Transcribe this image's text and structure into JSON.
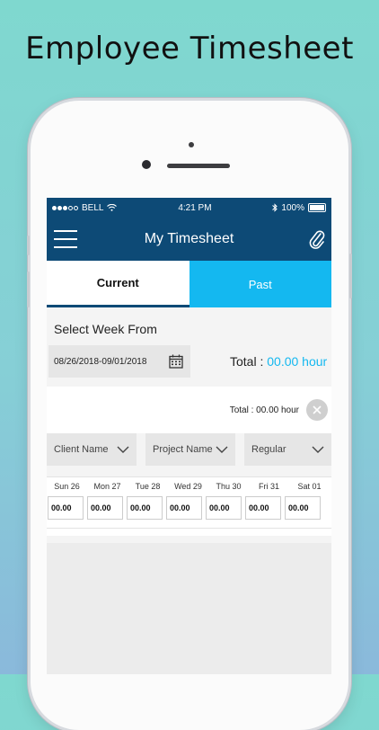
{
  "headline": "Employee Timesheet",
  "status_bar": {
    "carrier": "BELL",
    "time": "4:21 PM",
    "battery": "100%"
  },
  "nav": {
    "title": "My Timesheet"
  },
  "tabs": [
    {
      "label": "Current"
    },
    {
      "label": "Past"
    }
  ],
  "week": {
    "label": "Select Week From",
    "range": "08/26/2018-09/01/2018",
    "total_label": "Total : ",
    "total_value": "00.00 hour"
  },
  "entry": {
    "total": "Total : 00.00 hour",
    "selects": [
      {
        "value": "Client Name"
      },
      {
        "value": "Project Name"
      },
      {
        "value": "Regular"
      }
    ],
    "days": [
      "Sun 26",
      "Mon 27",
      "Tue 28",
      "Wed 29",
      "Thu 30",
      "Fri 31",
      "Sat 01"
    ],
    "hours": [
      "00.00",
      "00.00",
      "00.00",
      "00.00",
      "00.00",
      "00.00",
      "00.00"
    ]
  },
  "colors": {
    "navbar": "#0d4a76",
    "accent": "#14b8f0"
  }
}
